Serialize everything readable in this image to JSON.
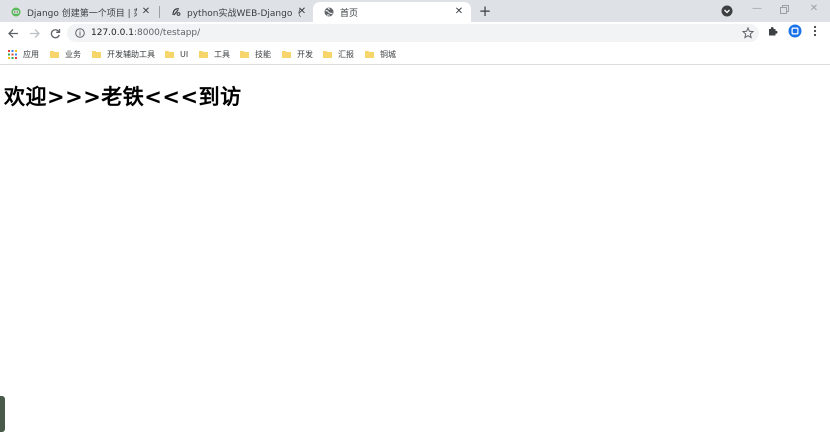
{
  "tabs": [
    {
      "title": "Django 创建第一个项目 | 菜鸟教",
      "icon": "runoob-favicon"
    },
    {
      "title": "python实战WEB-Django（一）",
      "icon": "django-favicon"
    },
    {
      "title": "首页",
      "icon": "globe-icon",
      "active": true
    }
  ],
  "toolbar": {
    "url_host": "127.0.0.1",
    "url_path": ":8000/testapp/"
  },
  "bookmarks": [
    {
      "label": "应用",
      "icon": "apps-grid-icon"
    },
    {
      "label": "业务",
      "icon": "folder-icon"
    },
    {
      "label": "开发辅助工具",
      "icon": "folder-icon"
    },
    {
      "label": "UI",
      "icon": "folder-icon"
    },
    {
      "label": "工具",
      "icon": "folder-icon"
    },
    {
      "label": "技能",
      "icon": "folder-icon"
    },
    {
      "label": "开发",
      "icon": "folder-icon"
    },
    {
      "label": "汇报",
      "icon": "folder-icon"
    },
    {
      "label": "铜城",
      "icon": "folder-icon"
    }
  ],
  "page": {
    "heading": "欢迎>>>老铁<<<到访"
  },
  "colors": {
    "tabstrip_bg": "#dee1e6",
    "omnibox_bg": "#f1f3f4",
    "folder": "#f6d66b",
    "profile": "#1a73e8"
  }
}
